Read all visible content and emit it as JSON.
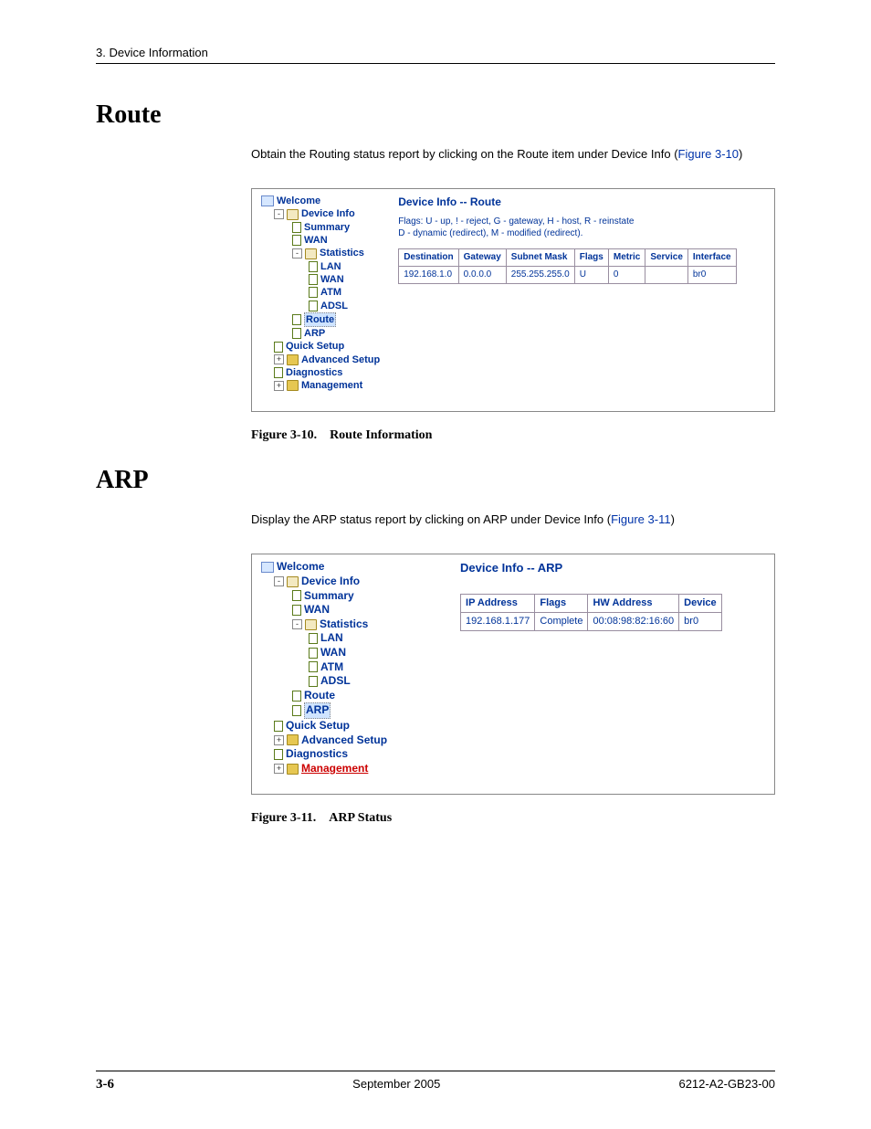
{
  "header": {
    "chapter": "3. Device Information"
  },
  "sections": {
    "route": {
      "title": "Route",
      "body_pre": "Obtain the Routing status report by clicking on the Route item under Device Info (",
      "body_link": "Figure 3-10",
      "body_post": ")"
    },
    "arp": {
      "title": "ARP",
      "body_pre": "Display the ARP status report by clicking on ARP under Device Info (",
      "body_link": "Figure 3-11",
      "body_post": ")"
    }
  },
  "nav": {
    "welcome": "Welcome",
    "device_info": "Device Info",
    "summary": "Summary",
    "wan": "WAN",
    "statistics": "Statistics",
    "lan": "LAN",
    "atm": "ATM",
    "adsl": "ADSL",
    "route": "Route",
    "arp": "ARP",
    "quick_setup": "Quick Setup",
    "advanced_setup": "Advanced Setup",
    "diagnostics": "Diagnostics",
    "management": "Management"
  },
  "fig310": {
    "title": "Device Info -- Route",
    "note1": "Flags: U - up, ! - reject, G - gateway, H - host, R - reinstate",
    "note2": "D - dynamic (redirect), M - modified (redirect).",
    "headers": {
      "destination": "Destination",
      "gateway": "Gateway",
      "subnet": "Subnet Mask",
      "flags": "Flags",
      "metric": "Metric",
      "service": "Service",
      "interface": "Interface"
    },
    "row": {
      "destination": "192.168.1.0",
      "gateway": "0.0.0.0",
      "subnet": "255.255.255.0",
      "flags": "U",
      "metric": "0",
      "service": "",
      "interface": "br0"
    },
    "caption": "Figure 3-10. Route Information"
  },
  "fig311": {
    "title": "Device Info -- ARP",
    "headers": {
      "ip": "IP Address",
      "flags": "Flags",
      "hw": "HW Address",
      "device": "Device"
    },
    "row": {
      "ip": "192.168.1.177",
      "flags": "Complete",
      "hw": "00:08:98:82:16:60",
      "device": "br0"
    },
    "caption": "Figure 3-11. ARP Status"
  },
  "footer": {
    "page": "3-6",
    "date": "September 2005",
    "doc": "6212-A2-GB23-00"
  }
}
